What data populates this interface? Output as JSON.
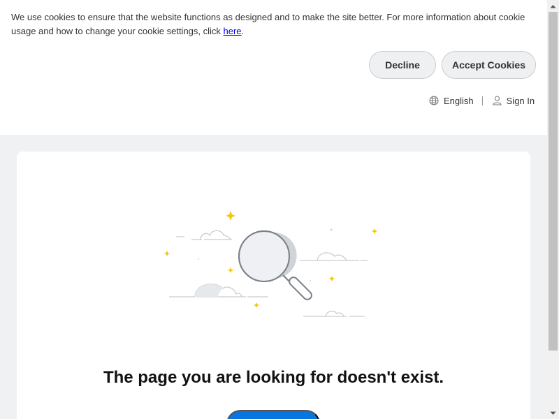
{
  "cookie_banner": {
    "message": "We use cookies to ensure that the website functions as designed and to make the site better. For more information about cookie usage and how to change your cookie settings, click ",
    "link_text": "here",
    "link_suffix": ".",
    "decline_label": "Decline",
    "accept_label": "Accept Cookies"
  },
  "header_nav": {
    "language_label": "English",
    "signin_label": "Sign In"
  },
  "main": {
    "error_message": "The page you are looking for doesn't exist.",
    "home_button_label": ""
  },
  "icons": {
    "language": "globe-icon",
    "signin": "user-icon",
    "illustration": "magnifying-glass-icon"
  },
  "colors": {
    "accent_blue": "#0875e1",
    "sparkle_yellow": "#f5c518",
    "page_background": "#f0f1f2"
  }
}
